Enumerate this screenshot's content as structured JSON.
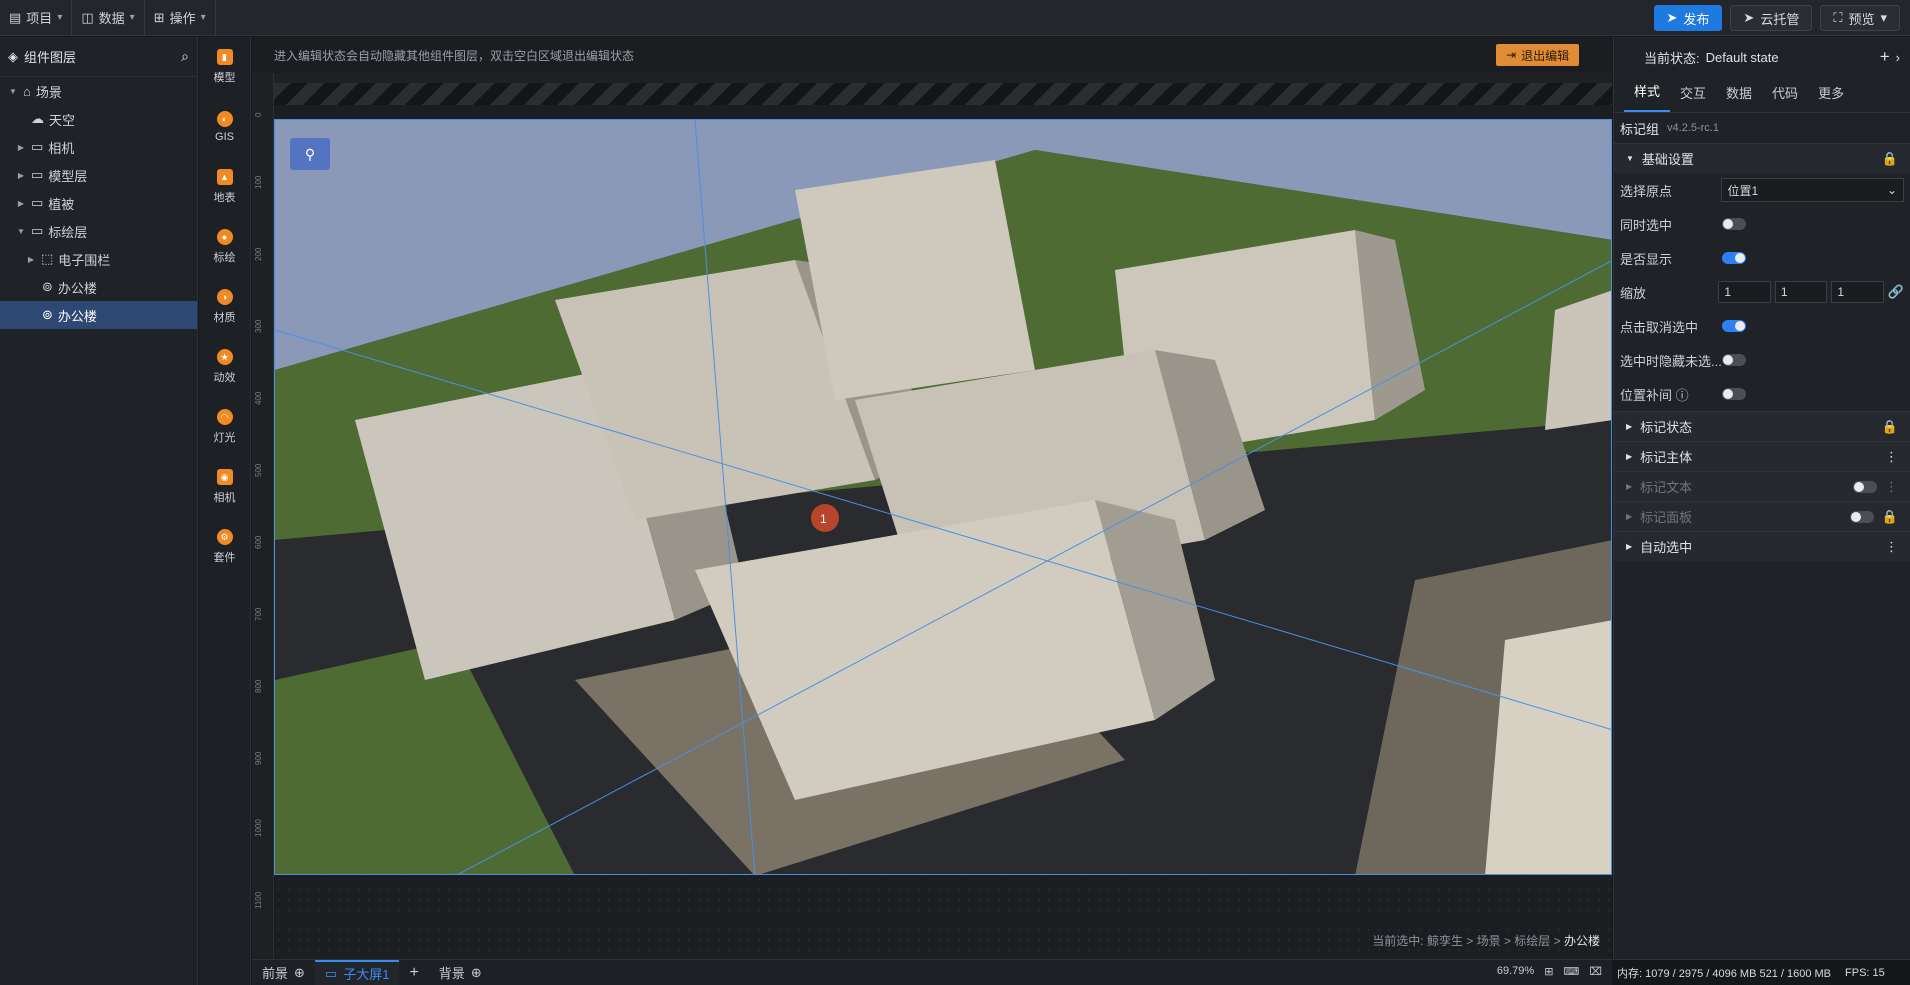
{
  "topbar": {
    "menus": [
      {
        "label": "项目"
      },
      {
        "label": "数据"
      },
      {
        "label": "操作"
      }
    ],
    "publish_label": "发布",
    "cloud_label": "云托管",
    "preview_label": "预览"
  },
  "layers": {
    "title": "组件图层",
    "items": [
      {
        "label": "场景"
      },
      {
        "label": "天空"
      },
      {
        "label": "相机"
      },
      {
        "label": "模型层"
      },
      {
        "label": "植被"
      },
      {
        "label": "标绘层"
      },
      {
        "label": "电子围栏"
      },
      {
        "label": "办公楼"
      },
      {
        "label": "办公楼"
      }
    ]
  },
  "tools": [
    {
      "label": "模型"
    },
    {
      "label": "GIS"
    },
    {
      "label": "地表"
    },
    {
      "label": "标绘"
    },
    {
      "label": "材质"
    },
    {
      "label": "动效"
    },
    {
      "label": "灯光"
    },
    {
      "label": "相机"
    },
    {
      "label": "套件"
    }
  ],
  "stage": {
    "hint": "进入编辑状态会自动隐藏其他组件图层，双击空白区域退出编辑状态",
    "exit_label": "退出编辑",
    "ruler_labels": [
      "0",
      "100",
      "200",
      "300",
      "400",
      "500",
      "600",
      "700",
      "800",
      "900",
      "1000",
      "1100"
    ],
    "breadcrumb_prefix": "当前选中:",
    "breadcrumb_path": "鲸孪生 > 场景 > 标绘层 >",
    "breadcrumb_current": "办公楼",
    "marker_label": "1"
  },
  "bottom": {
    "tabs": [
      {
        "label": "前景"
      },
      {
        "label": "子大屏1"
      },
      {
        "label": "背景"
      }
    ],
    "zoom": "69.79%"
  },
  "right": {
    "state_label": "当前状态:",
    "state_value": "Default state",
    "tabs": [
      {
        "label": "样式"
      },
      {
        "label": "交互"
      },
      {
        "label": "数据"
      },
      {
        "label": "代码"
      },
      {
        "label": "更多"
      }
    ],
    "component_name": "标记组",
    "component_version": "v4.2.5-rc.1",
    "basic_section": "基础设置",
    "props": {
      "origin_label": "选择原点",
      "origin_value": "位置1",
      "sync_label": "同时选中",
      "show_label": "是否显示",
      "scale_label": "缩放",
      "scale_x": "1",
      "scale_y": "1",
      "scale_z": "1",
      "cancel_label": "点击取消选中",
      "hide_label": "选中时隐藏未选...",
      "tween_label": "位置补间"
    },
    "sections": [
      {
        "label": "标记状态"
      },
      {
        "label": "标记主体"
      },
      {
        "label": "标记文本"
      },
      {
        "label": "标记面板"
      },
      {
        "label": "自动选中"
      }
    ]
  },
  "status": {
    "memory": "内存:  1079 / 2975 / 4096 MB   521 / 1600 MB",
    "fps": "FPS:  15"
  }
}
